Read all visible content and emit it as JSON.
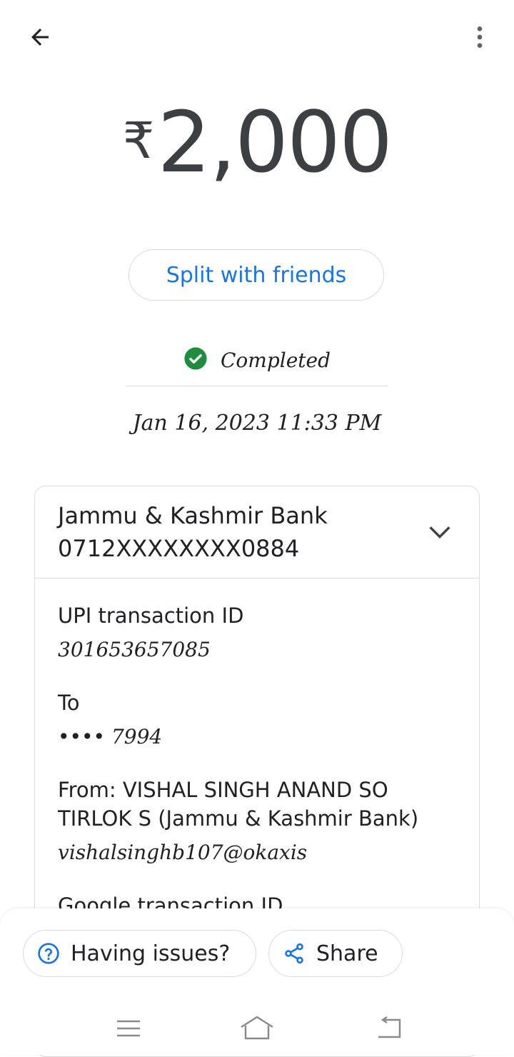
{
  "header": {
    "back_icon": "arrow-back-icon",
    "more_icon": "more-vert-icon"
  },
  "amount": {
    "currency": "₹",
    "value": "2,000",
    "color": "#3c4043"
  },
  "split_button": {
    "label": "Split with friends",
    "color": "#1a73e8"
  },
  "status": {
    "text": "Completed",
    "icon": "check-circle-icon",
    "color": "#1e8e3e"
  },
  "timestamp": "Jan 16, 2023 11:33 PM",
  "account": {
    "bank_name": "Jammu & Kashmir Bank",
    "account_number": "0712XXXXXXXX0884",
    "expand_icon": "chevron-down-icon"
  },
  "details": {
    "upi_label": "UPI transaction ID",
    "upi_value": "301653657085",
    "to_label": "To",
    "to_value": "•••• 7994",
    "from_line1": "From: VISHAL SINGH ANAND SO",
    "from_line2": "TIRLOK S (Jammu & Kashmir Bank)",
    "from_upi": "vishalsinghb107@okaxis",
    "google_label": "Google transaction ID"
  },
  "bottom_actions": {
    "issues_label": "Having issues?",
    "issues_icon": "help-circle-icon",
    "share_label": "Share",
    "share_icon": "share-icon"
  },
  "system_nav": {
    "menu_icon": "menu-icon",
    "home_icon": "home-icon",
    "back_icon": "nav-back-icon"
  }
}
